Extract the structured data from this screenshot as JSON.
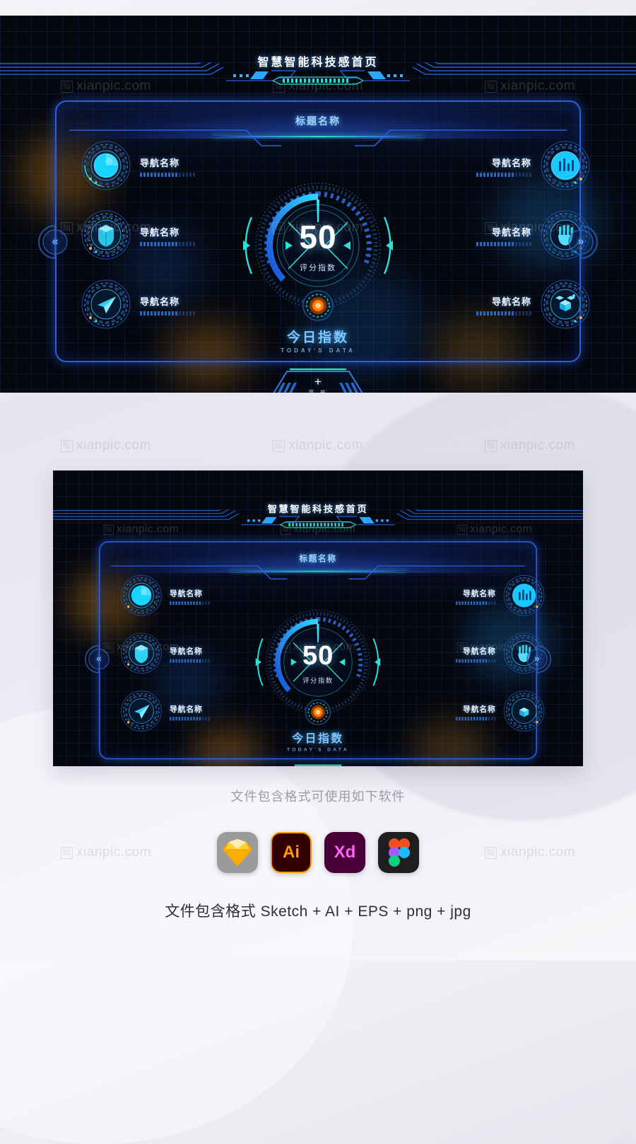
{
  "header": {
    "title": "智慧智能科技感首页"
  },
  "panel": {
    "title": "标题名称"
  },
  "nav": {
    "left": [
      {
        "label": "导航名称",
        "icon": "pie-sphere-icon"
      },
      {
        "label": "导航名称",
        "icon": "cube-shield-icon"
      },
      {
        "label": "导航名称",
        "icon": "paper-plane-icon"
      }
    ],
    "right": [
      {
        "label": "导航名称",
        "icon": "bar-chart-icon"
      },
      {
        "label": "导航名称",
        "icon": "hand-icon"
      },
      {
        "label": "导航名称",
        "icon": "blocks-icon"
      }
    ]
  },
  "arrows": {
    "prev": "«",
    "next": "»",
    "prev_icon": "chevron-double-left-icon",
    "next_icon": "chevron-double-right-icon"
  },
  "gauge": {
    "value": "50",
    "label": "评分指数",
    "percent": 50
  },
  "today": {
    "cn": "今日指数",
    "en": "TODAY'S DATA"
  },
  "menu": {
    "plus": "+",
    "label": "菜 单"
  },
  "footer": {
    "software_title": "文件包含格式可使用如下软件",
    "software": [
      {
        "name": "Sketch",
        "label": "",
        "icon": "sketch-icon"
      },
      {
        "name": "Adobe Illustrator",
        "label": "Ai",
        "icon": "illustrator-icon"
      },
      {
        "name": "Adobe XD",
        "label": "Xd",
        "icon": "xd-icon"
      },
      {
        "name": "Figma",
        "label": "",
        "icon": "figma-icon"
      }
    ],
    "caption": "文件包含格式 Sketch + AI + EPS + png + jpg"
  },
  "watermark": {
    "mark": "仙",
    "text": "xianpic.com"
  },
  "colors": {
    "accent_blue": "#2a5fe0",
    "accent_cyan": "#25e6b0",
    "title_blue": "#9fd4ff",
    "orange_orb": "#ff7a00",
    "board_bg": "#05070e"
  }
}
